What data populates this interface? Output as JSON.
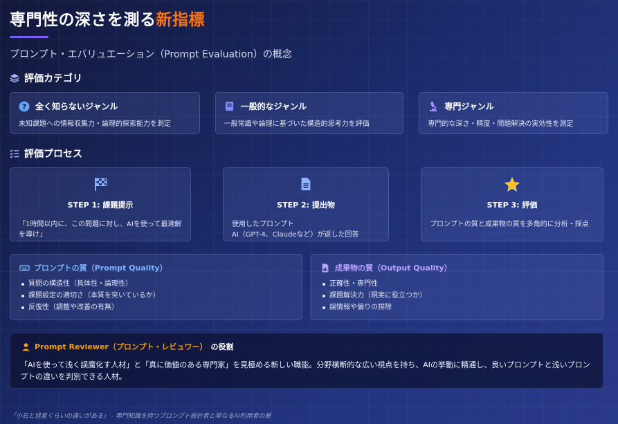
{
  "header": {
    "title_main": "専門性の深さを測る",
    "title_accent": "新指標",
    "subtitle": "プロンプト・エバリュエーション（Prompt Evaluation）の概念"
  },
  "categories_section": {
    "heading": "評価カテゴリ",
    "icon": "layers-icon",
    "items": [
      {
        "icon": "question-circle-icon",
        "title": "全く知らないジャンル",
        "desc": "未知課題への情報収集力・論理的探索能力を測定"
      },
      {
        "icon": "book-icon",
        "title": "一般的なジャンル",
        "desc": "一般常識や論理に基づいた構造的思考力を評価"
      },
      {
        "icon": "microscope-icon",
        "title": "専門ジャンル",
        "desc": "専門的な深さ・精度・問題解決の実効性を測定"
      }
    ]
  },
  "process_section": {
    "heading": "評価プロセス",
    "icon": "checklist-icon",
    "steps": [
      {
        "icon": "checkered-flag-icon",
        "title": "STEP 1: 課題提示",
        "body": "「1時間以内に、この問題に対し、AIを使って最適解を導け」"
      },
      {
        "icon": "document-icon",
        "title": "STEP 2: 提出物",
        "body_line1": "使用したプロンプト",
        "body_line2": "AI（GPT-4、Claudeなど）が返した回答"
      },
      {
        "icon": "star-icon",
        "title": "STEP 3: 評価",
        "body": "プロンプトの質と成果物の質を多角的に分析・採点"
      }
    ]
  },
  "quality": {
    "prompt": {
      "icon": "keyboard-icon",
      "title": "プロンプトの質（Prompt Quality）",
      "items": [
        "質問の構造性（具体性・論理性）",
        "課題設定の適切さ（本質を突いているか）",
        "反復性（調整や改善の有無）"
      ]
    },
    "output": {
      "icon": "file-chart-icon",
      "title": "成果物の質（Output Quality）",
      "items": [
        "正確性・専門性",
        "課題解決力（現実に役立つか）",
        "誤情報や偏りの排除"
      ]
    }
  },
  "reviewer": {
    "icon": "user-icon",
    "title_accent": "Prompt Reviewer（プロンプト・レビュワー）",
    "title_rest": "の役割",
    "body": "「AIを使って浅く誤魔化す人材」と「真に価値のある専門家」を見極める新しい職能。分野横断的な広い視点を持ち、AIの挙動に精通し、良いプロンプトと浅いプロンプトの違いを判別できる人材。"
  },
  "footer": {
    "text": "「小石と惑星くらいの違いがある」 - 専門知識を持つプロンプト設計者と単なるAI利用者の差"
  },
  "colors": {
    "accent_orange": "#f97316",
    "prompt_quality_blue": "#7db4ff",
    "output_quality_purple": "#b9a3ff",
    "reviewer_orange": "#f59e0b"
  }
}
